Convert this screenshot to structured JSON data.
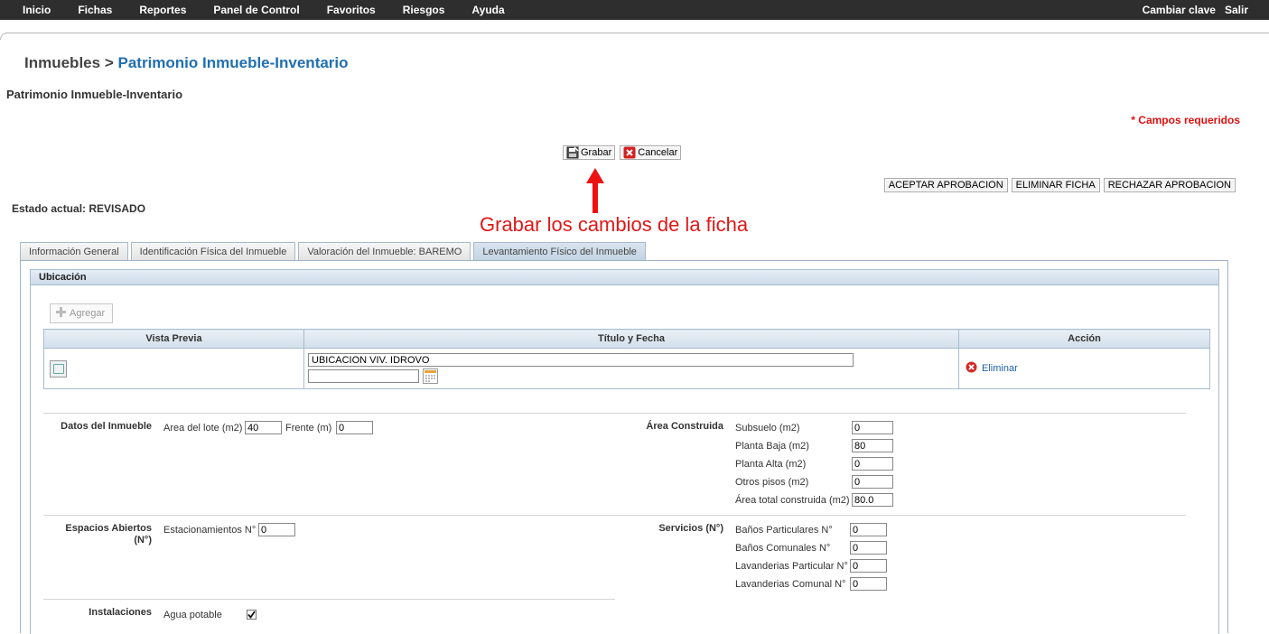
{
  "nav": {
    "items": [
      "Inicio",
      "Fichas",
      "Reportes",
      "Panel de Control",
      "Favoritos",
      "Riesgos",
      "Ayuda"
    ],
    "right": [
      "Cambiar clave",
      "Salir"
    ]
  },
  "breadcrumb": {
    "parent": "Inmuebles",
    "separator": ">",
    "current": "Patrimonio Inmueble-Inventario"
  },
  "subtitle": "Patrimonio Inmueble-Inventario",
  "required_note": "* Campos requeridos",
  "actions": {
    "save": "Grabar",
    "cancel": "Cancelar"
  },
  "approvals": [
    "ACEPTAR APROBACION",
    "ELIMINAR FICHA",
    "RECHAZAR APROBACION"
  ],
  "annotation": "Grabar los cambios de la ficha",
  "estado": "Estado actual: REVISADO",
  "tabs": [
    "Información General",
    "Identificación Física del Inmueble",
    "Valoración del Inmueble: BAREMO",
    "Levantamiento Físico del Inmueble"
  ],
  "section": {
    "title": "Ubicación",
    "add": "Agregar",
    "columns": [
      "Vista Previa",
      "Título y Fecha",
      "Acción"
    ],
    "row": {
      "title": "UBICACION VIV. IDROVO",
      "date": "",
      "action": "Eliminar"
    }
  },
  "datos": {
    "label": "Datos del Inmueble",
    "area_lote_label": "Area del lote (m2)",
    "area_lote": "40",
    "frente_label": "Frente (m)",
    "frente": "0"
  },
  "area_construida": {
    "label": "Área Construida",
    "fields": [
      {
        "label": "Subsuelo (m2)",
        "value": "0"
      },
      {
        "label": "Planta Baja (m2)",
        "value": "80"
      },
      {
        "label": "Planta Alta (m2)",
        "value": "0"
      },
      {
        "label": "Otros pisos (m2)",
        "value": "0"
      },
      {
        "label": "Área total construida (m2)",
        "value": "80.0"
      }
    ]
  },
  "espacios": {
    "label": "Espacios Abiertos",
    "label2": "(N°)",
    "estac_label": "Estacionamientos N°",
    "estac": "0"
  },
  "servicios": {
    "label": "Servicios (N°)",
    "fields": [
      {
        "label": "Baños Particulares N°",
        "value": "0"
      },
      {
        "label": "Baños Comunales N°",
        "value": "0"
      },
      {
        "label": "Lavanderias Particular N°",
        "value": "0"
      },
      {
        "label": "Lavanderias Comunal N°",
        "value": "0"
      }
    ]
  },
  "instalaciones": {
    "label": "Instalaciones",
    "items": [
      {
        "label": "Agua potable",
        "checked": true
      }
    ]
  }
}
